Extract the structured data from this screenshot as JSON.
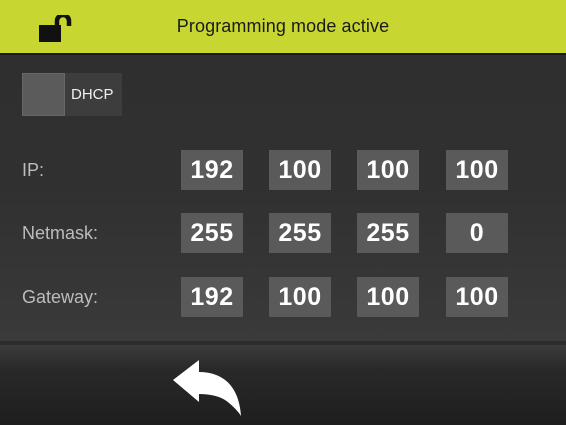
{
  "header": {
    "title": "Programming mode active",
    "lock_icon": "unlocked-padlock-icon",
    "background_color": "#c8d632"
  },
  "dhcp": {
    "label": "DHCP",
    "checked": false
  },
  "network": {
    "ip": {
      "label": "IP:",
      "octets": [
        "192",
        "100",
        "100",
        "100"
      ]
    },
    "netmask": {
      "label": "Netmask:",
      "octets": [
        "255",
        "255",
        "255",
        "0"
      ]
    },
    "gateway": {
      "label": "Gateway:",
      "octets": [
        "192",
        "100",
        "100",
        "100"
      ]
    }
  },
  "footer": {
    "back_icon": "back-arrow-icon"
  }
}
